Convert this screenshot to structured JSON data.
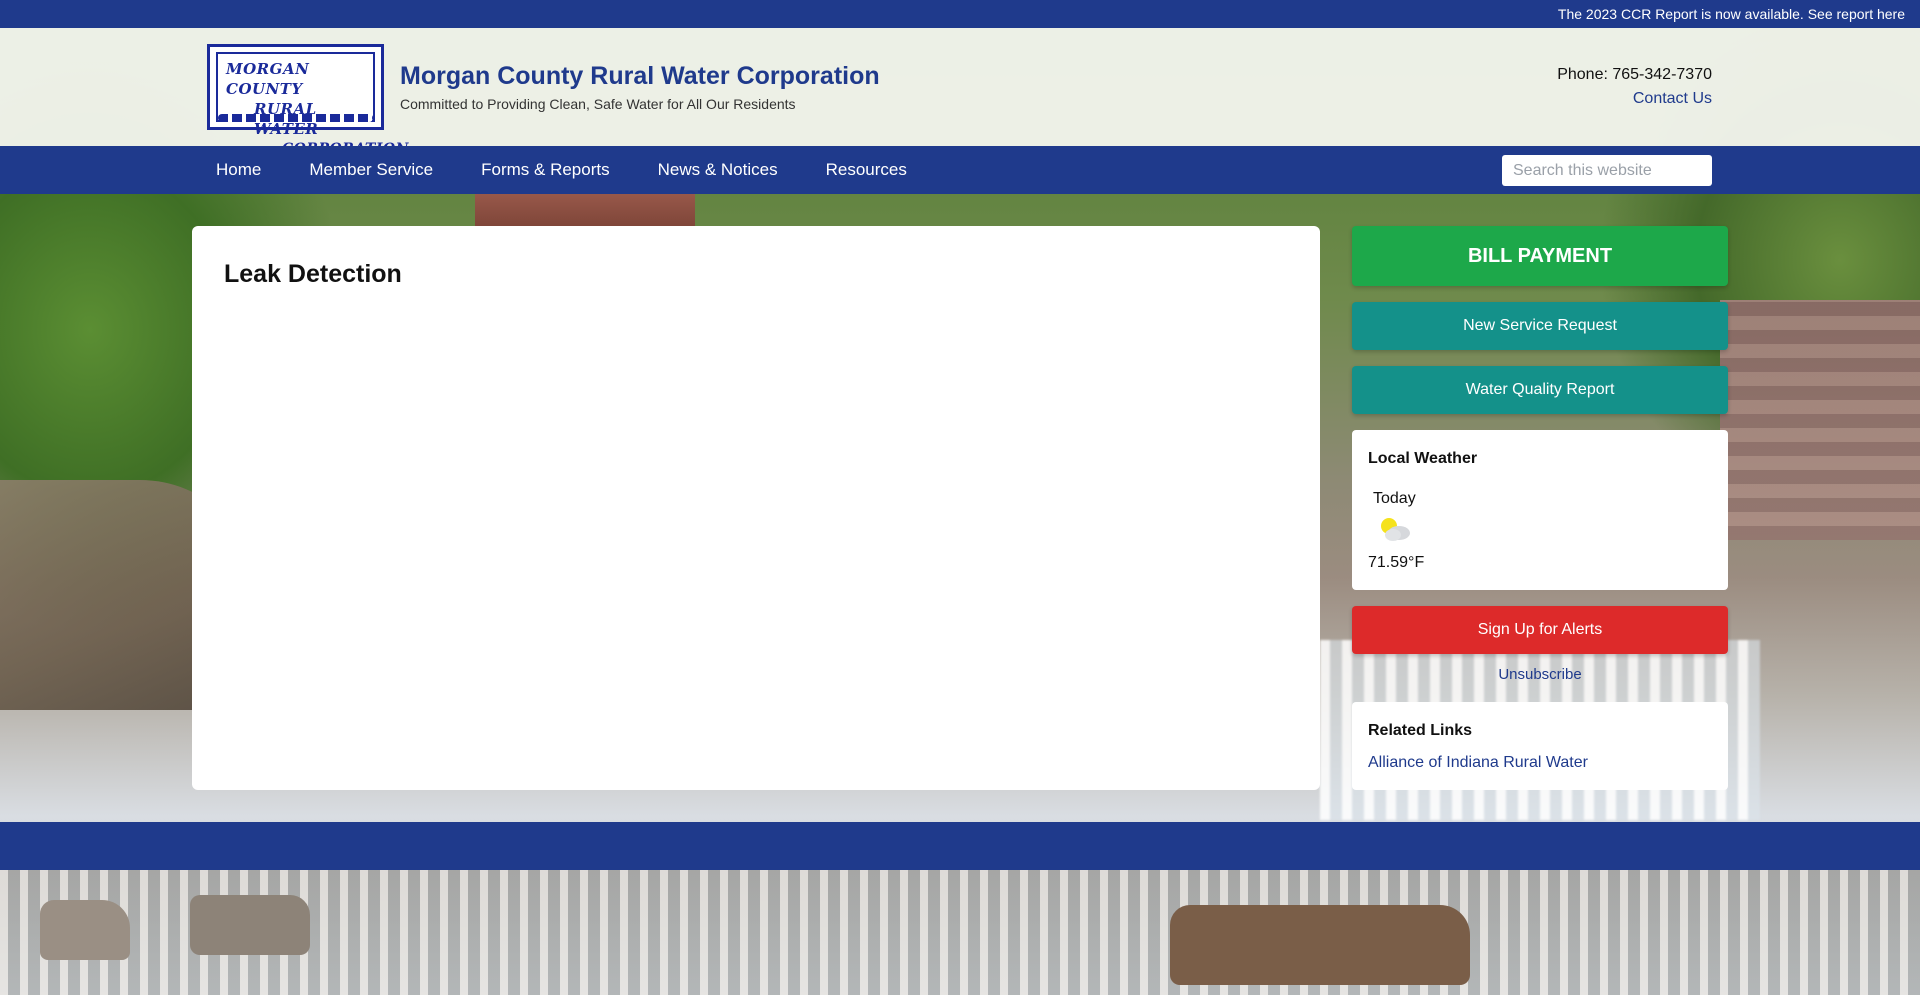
{
  "announcement": {
    "text": "The 2023 CCR Report is now available. See report here"
  },
  "header": {
    "logo_lines": [
      "MORGAN COUNTY",
      "RURAL WATER",
      "CORPORATION"
    ],
    "title": "Morgan County Rural Water Corporation",
    "tagline": "Committed to Providing Clean, Safe Water for All Our Residents",
    "phone": "Phone: 765-342-7370",
    "contact_label": "Contact Us"
  },
  "nav": {
    "items": [
      {
        "label": "Home"
      },
      {
        "label": "Member Service"
      },
      {
        "label": "Forms & Reports"
      },
      {
        "label": "News & Notices"
      },
      {
        "label": "Resources"
      }
    ],
    "search_placeholder": "Search this website"
  },
  "main": {
    "title": "Leak Detection"
  },
  "sidebar": {
    "bill_payment": "BILL PAYMENT",
    "new_service": "New Service Request",
    "water_quality": "Water Quality Report",
    "weather": {
      "heading": "Local Weather",
      "day": "Today",
      "icon": "partly-cloudy-icon",
      "temp": "71.59°F"
    },
    "alerts": "Sign Up for Alerts",
    "unsubscribe": "Unsubscribe",
    "related": {
      "heading": "Related Links",
      "link": "Alliance of Indiana Rural Water"
    }
  },
  "colors": {
    "brand_blue": "#1f3a8c",
    "bill_green": "#1da84a",
    "teal": "#14918a",
    "alert_red": "#dd2a2a"
  }
}
